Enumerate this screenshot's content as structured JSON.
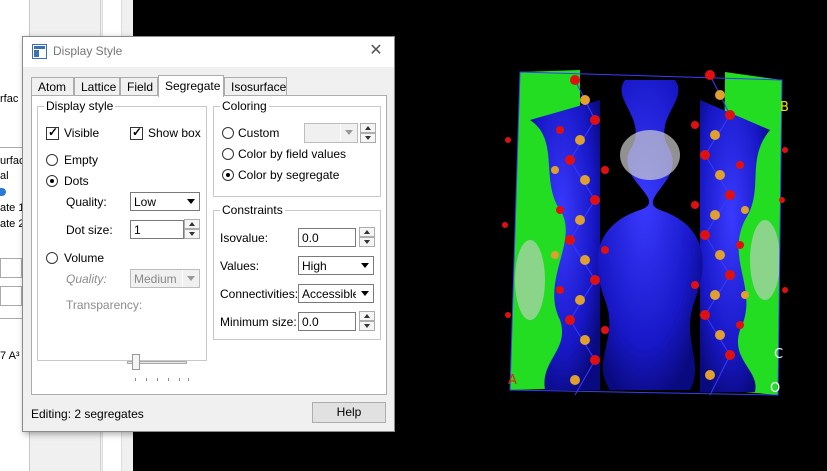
{
  "background_window": {
    "frag_lines": [
      "rfac",
      "urfac",
      "al",
      "ate 1",
      "ate 2",
      "7 A³"
    ]
  },
  "dialog": {
    "title": "Display Style",
    "close_glyph": "✕",
    "tabs": [
      "Atom",
      "Lattice",
      "Field",
      "Segregate",
      "Isosurface"
    ],
    "active_tab": "Segregate",
    "display_style": {
      "group_title": "Display style",
      "visible_label": "Visible",
      "visible_checked": true,
      "show_box_label": "Show box",
      "show_box_checked": true,
      "empty_label": "Empty",
      "dots_label": "Dots",
      "quality_label": "Quality:",
      "quality_value": "Low",
      "dot_size_label": "Dot size:",
      "dot_size_value": "1",
      "volume_label": "Volume",
      "volume_quality_label": "Quality:",
      "volume_quality_value": "Medium",
      "transparency_label": "Transparency:",
      "selected_style": "Dots"
    },
    "coloring": {
      "group_title": "Coloring",
      "custom_label": "Custom",
      "field_values_label": "Color by field values",
      "segregate_label": "Color by segregate",
      "selected": "Color by segregate"
    },
    "constraints": {
      "group_title": "Constraints",
      "isovalue_label": "Isovalue:",
      "isovalue_value": "0.0",
      "values_label": "Values:",
      "values_value": "High",
      "connectivities_label": "Connectivities:",
      "connectivities_value": "Accessible",
      "min_size_label": "Minimum size:",
      "min_size_value": "0.0"
    },
    "status_text": "Editing: 2 segregates",
    "help_label": "Help"
  },
  "viewport": {
    "labels": {
      "B": "B",
      "C": "C",
      "O": "O",
      "A": "A"
    },
    "colors": {
      "background": "#000000",
      "pore_surface": "#1a1ae6",
      "box_faces": "#22e022",
      "oxygen": "#e01010",
      "silicon": "#e0a030",
      "dots": "#cccccc"
    }
  }
}
